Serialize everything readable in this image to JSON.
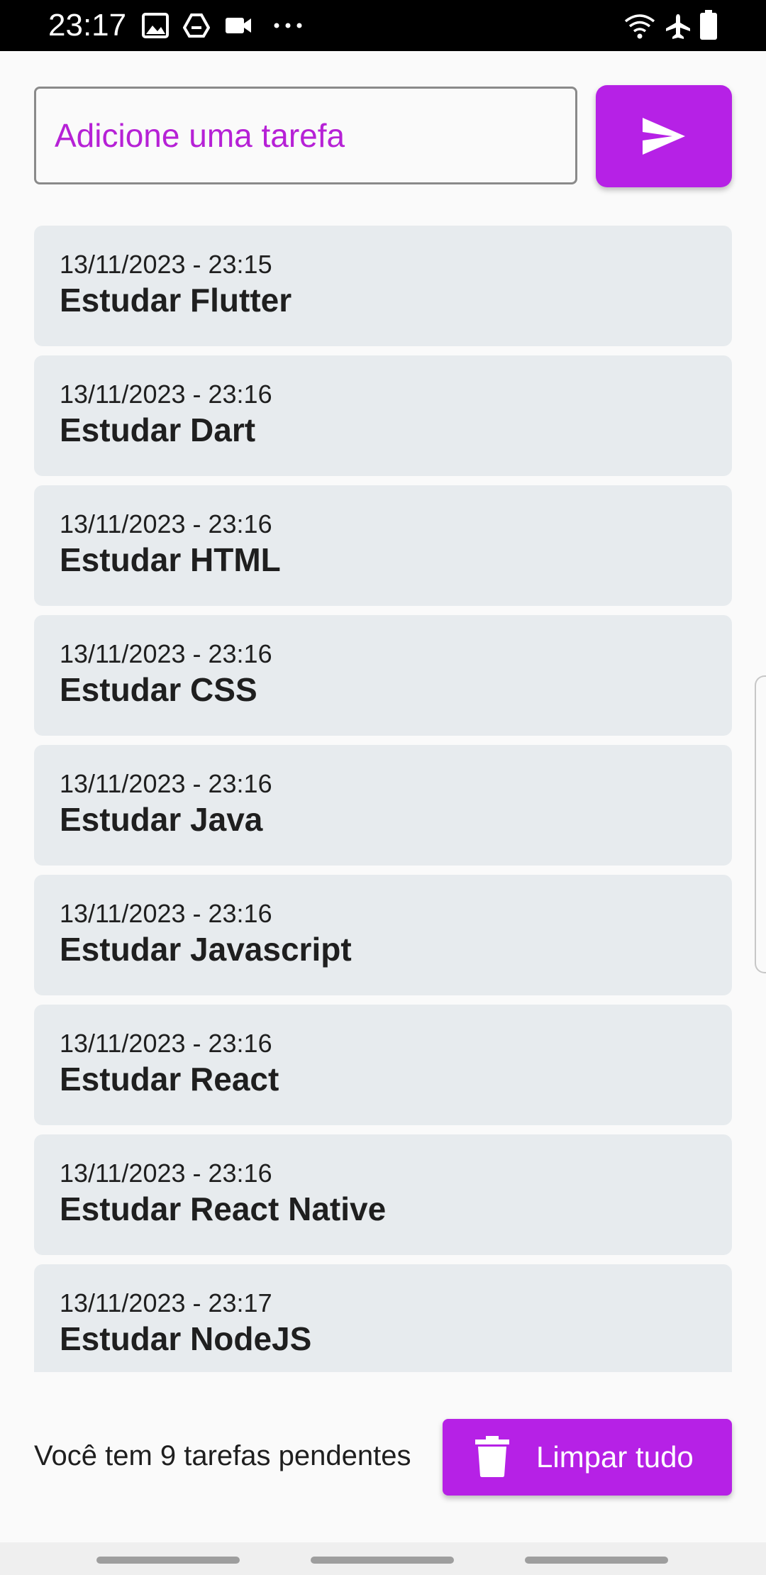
{
  "status_bar": {
    "time": "23:17",
    "left_icons": [
      "image-icon",
      "drive-icon",
      "video-icon",
      "more-dots-icon"
    ],
    "right_icons": [
      "wifi-icon",
      "airplane-icon",
      "battery-icon"
    ]
  },
  "input": {
    "placeholder": "Adicione uma tarefa",
    "value": ""
  },
  "send_button": {
    "icon": "send-icon"
  },
  "tasks": [
    {
      "date": "13/11/2023 - 23:15",
      "title": "Estudar Flutter"
    },
    {
      "date": "13/11/2023 - 23:16",
      "title": "Estudar Dart"
    },
    {
      "date": "13/11/2023 - 23:16",
      "title": "Estudar HTML"
    },
    {
      "date": "13/11/2023 - 23:16",
      "title": "Estudar CSS"
    },
    {
      "date": "13/11/2023 - 23:16",
      "title": "Estudar Java"
    },
    {
      "date": "13/11/2023 - 23:16",
      "title": "Estudar Javascript"
    },
    {
      "date": "13/11/2023 - 23:16",
      "title": "Estudar React"
    },
    {
      "date": "13/11/2023 - 23:16",
      "title": "Estudar React Native"
    },
    {
      "date": "13/11/2023 - 23:17",
      "title": "Estudar NodeJS"
    }
  ],
  "footer": {
    "pending_text": "Você tem 9 tarefas pendentes",
    "clear_label": "Limpar tudo",
    "clear_icon": "trash-icon"
  },
  "colors": {
    "accent": "#b621e6",
    "card_bg": "#e7ebee",
    "background": "#fafafa"
  }
}
